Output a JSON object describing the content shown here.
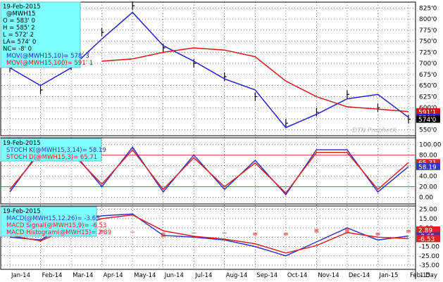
{
  "price_panel": {
    "info": [
      "19-Feb-2015",
      "@MWH15",
      "O = 583' 0",
      "H = 585' 2",
      "L = 572' 2",
      "LA= 574' 0",
      "NC= -8' 0",
      "MOV(@MWH15,10)= 578' 3",
      "MOV(@MWH15,100)= 591' 1"
    ],
    "y_ticks": [
      "825'0",
      "800'0",
      "775'0",
      "750'0",
      "725'0",
      "700'0",
      "675'0",
      "650'0",
      "625'0",
      "600'0",
      "575'0",
      "550'0"
    ],
    "tags": [
      "591'1",
      "578'3",
      "574'0"
    ],
    "watermark": "DTN ProphetX"
  },
  "stoch_panel": {
    "info": [
      "19-Feb-2015",
      "STOCH K(@MWH15,3,14)= 58.19",
      "STOCH D(@MWH15,3)= 65.71"
    ],
    "y_ticks": [
      "100.00",
      "80.00",
      "60.00",
      "40.00",
      "20.00",
      "0.00"
    ],
    "tags": [
      "65.71",
      "58.19"
    ]
  },
  "macd_panel": {
    "info": [
      "19-Feb-2015",
      "MACD(@MWH15,12,26)= -3.65",
      "MACD Signal(@MWH15,9)= -6.53",
      "MACD Histogram(@MWH15)= 2.89"
    ],
    "y_ticks": [
      "25.00",
      "15.00",
      "5.00",
      "-5.00",
      "-15.00",
      "-25.00",
      "-35.00"
    ],
    "tags": [
      "2.89",
      "-3.65",
      "-6.53"
    ]
  },
  "x_axis": {
    "labels": [
      "Jan-14",
      "Feb-14",
      "Mar-14",
      "Apr-14",
      "May-14",
      "Jun-14",
      "Jul-14",
      "Aug-14",
      "Sep-14",
      "Oct-14",
      "Nov-14",
      "Dec-14",
      "Jan-15",
      "Feb-15"
    ],
    "interval": "1 Day"
  },
  "colors": {
    "info_bg": "#7fffff",
    "mov10": "#1f1fd6",
    "mov100": "#dd1111",
    "stoch_k": "#3333cc",
    "stoch_d": "#dd2222",
    "macd": "#3333cc",
    "signal": "#dd2222",
    "histogram": "#dd2222",
    "bars": "#000000"
  },
  "chart_data": [
    {
      "type": "line",
      "title": "@MWH15",
      "series": [
        {
          "name": "@MWH15",
          "x": [
            "Jan-14",
            "Feb-14",
            "Mar-14",
            "Apr-14",
            "May-14",
            "Jun-14",
            "Jul-14",
            "Aug-14",
            "Sep-14",
            "Oct-14",
            "Nov-14",
            "Dec-14",
            "Jan-15",
            "Feb-15"
          ],
          "values": [
            690,
            640,
            695,
            770,
            830,
            735,
            700,
            670,
            625,
            565,
            590,
            630,
            600,
            574
          ]
        },
        {
          "name": "MOV(@MWH15,10)",
          "x": [
            "Jan-14",
            "Feb-14",
            "Mar-14",
            "Apr-14",
            "May-14",
            "Jun-14",
            "Jul-14",
            "Aug-14",
            "Sep-14",
            "Oct-14",
            "Nov-14",
            "Dec-14",
            "Jan-15",
            "Feb-15"
          ],
          "values": [
            690,
            650,
            690,
            755,
            815,
            740,
            705,
            665,
            640,
            555,
            585,
            620,
            630,
            578.38
          ]
        },
        {
          "name": "MOV(@MWH15,100)",
          "x": [
            "Jan-14",
            "Feb-14",
            "Mar-14",
            "Apr-14",
            "May-14",
            "Jun-14",
            "Jul-14",
            "Aug-14",
            "Sep-14",
            "Oct-14",
            "Nov-14",
            "Dec-14",
            "Jan-15",
            "Feb-15"
          ],
          "values": [
            null,
            null,
            null,
            705,
            710,
            725,
            735,
            730,
            715,
            660,
            625,
            602,
            597,
            591.13
          ]
        }
      ],
      "ylim": [
        540,
        835
      ]
    },
    {
      "type": "line",
      "series": [
        {
          "name": "STOCH K(@MWH15,3,14)",
          "x": [
            "Jan-14",
            "Feb-14",
            "Mar-14",
            "Apr-14",
            "May-14",
            "Jun-14",
            "Jul-14",
            "Aug-14",
            "Sep-14",
            "Oct-14",
            "Nov-14",
            "Dec-14",
            "Jan-15",
            "Feb-15"
          ],
          "values": [
            10,
            90,
            90,
            20,
            95,
            10,
            80,
            15,
            70,
            5,
            90,
            90,
            10,
            58.19
          ]
        },
        {
          "name": "STOCH D(@MWH15,3)",
          "x": [
            "Jan-14",
            "Feb-14",
            "Mar-14",
            "Apr-14",
            "May-14",
            "Jun-14",
            "Jul-14",
            "Aug-14",
            "Sep-14",
            "Oct-14",
            "Nov-14",
            "Dec-14",
            "Jan-15",
            "Feb-15"
          ],
          "values": [
            15,
            85,
            85,
            25,
            90,
            15,
            75,
            20,
            65,
            8,
            85,
            85,
            15,
            65.71
          ]
        }
      ],
      "ylim": [
        -10,
        110
      ]
    },
    {
      "type": "line",
      "series": [
        {
          "name": "MACD(@MWH15,12,26)",
          "x": [
            "Jan-14",
            "Feb-14",
            "Mar-14",
            "Apr-14",
            "May-14",
            "Jun-14",
            "Jul-14",
            "Aug-14",
            "Sep-14",
            "Oct-14",
            "Nov-14",
            "Dec-14",
            "Jan-15",
            "Feb-15"
          ],
          "values": [
            -5,
            -8,
            10,
            18,
            20,
            -3,
            -5,
            -8,
            -15,
            -25,
            -10,
            5,
            -8,
            -3.65
          ]
        },
        {
          "name": "MACD Signal(@MWH15,9)",
          "x": [
            "Jan-14",
            "Feb-14",
            "Mar-14",
            "Apr-14",
            "May-14",
            "Jun-14",
            "Jul-14",
            "Aug-14",
            "Sep-14",
            "Oct-14",
            "Nov-14",
            "Dec-14",
            "Jan-15",
            "Feb-15"
          ],
          "values": [
            -3,
            -9,
            5,
            15,
            19,
            2,
            -4,
            -7,
            -12,
            -22,
            -14,
            0,
            -5,
            -6.53
          ]
        },
        {
          "name": "MACD Histogram(@MWH15)",
          "x": [
            "Jan-14",
            "Feb-14",
            "Mar-14",
            "Apr-14",
            "May-14",
            "Jun-14",
            "Jul-14",
            "Aug-14",
            "Sep-14",
            "Oct-14",
            "Nov-14",
            "Dec-14",
            "Jan-15",
            "Feb-15"
          ],
          "values": [
            -2,
            1,
            5,
            3,
            1,
            -5,
            -1,
            -1,
            -3,
            -3,
            4,
            5,
            -3,
            2.89
          ]
        }
      ],
      "ylim": [
        -38,
        27
      ]
    }
  ]
}
